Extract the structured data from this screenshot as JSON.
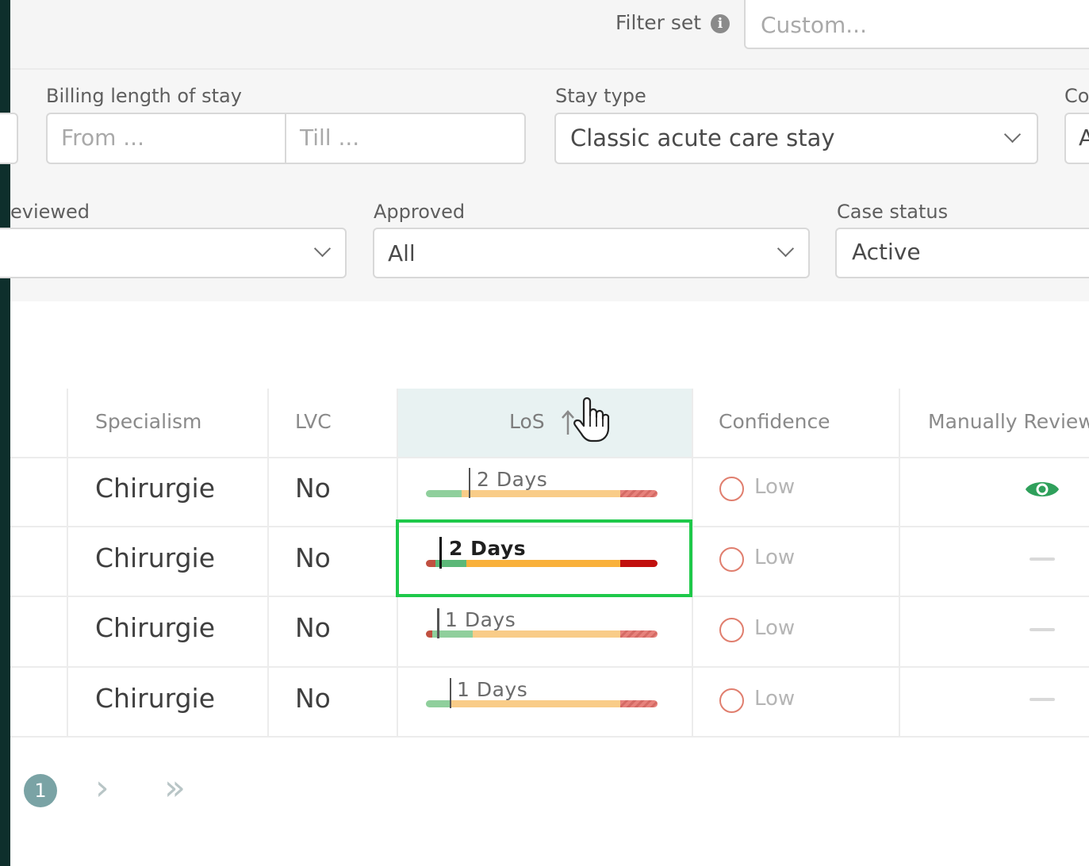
{
  "top": {
    "filter_set_label": "Filter set",
    "filter_set_placeholder": "Custom..."
  },
  "filters": {
    "billing_length_label": "Billing length of stay",
    "billing_from_placeholder": "From ...",
    "billing_till_placeholder": "Till ...",
    "stay_type_label": "Stay type",
    "stay_type_value": "Classic acute care stay",
    "next_col_label_partial": "Co",
    "next_col_value_partial": "A",
    "reviewed_label_partial": "eviewed",
    "approved_label": "Approved",
    "approved_value": "All",
    "case_status_label": "Case status",
    "case_status_value": "Active"
  },
  "table": {
    "headers": {
      "specialism": "Specialism",
      "lvc": "LVC",
      "los": "LoS",
      "confidence": "Confidence",
      "manually_reviewed": "Manually Review"
    },
    "rows": [
      {
        "specialism": "Chirurgie",
        "lvc": "No",
        "los_label": "2 Days",
        "los_value_pct": 0.19,
        "confidence": "Low",
        "manually_reviewed": "eye"
      },
      {
        "specialism": "Chirurgie",
        "lvc": "No",
        "los_label": "2 Days",
        "los_value_pct": 0.07,
        "confidence": "Low",
        "manually_reviewed": "dash"
      },
      {
        "specialism": "Chirurgie",
        "lvc": "No",
        "los_label": "1 Days",
        "los_value_pct": 0.05,
        "confidence": "Low",
        "manually_reviewed": "dash"
      },
      {
        "specialism": "Chirurgie",
        "lvc": "No",
        "los_label": "1 Days",
        "los_value_pct": 0.11,
        "confidence": "Low",
        "manually_reviewed": "dash"
      }
    ]
  },
  "pagination": {
    "current_page": "1",
    "next_glyph": "›",
    "last_glyph": "»"
  },
  "colors": {
    "highlight": "#1ec94a",
    "sidebar": "#0e2f2c",
    "los_header_bg": "#e8f2f2",
    "confidence_ring": "#e07e6e"
  },
  "icons": [
    "info-icon",
    "chevron-down-icon",
    "sort-ascending-icon",
    "hand-cursor-icon",
    "eye-icon"
  ]
}
